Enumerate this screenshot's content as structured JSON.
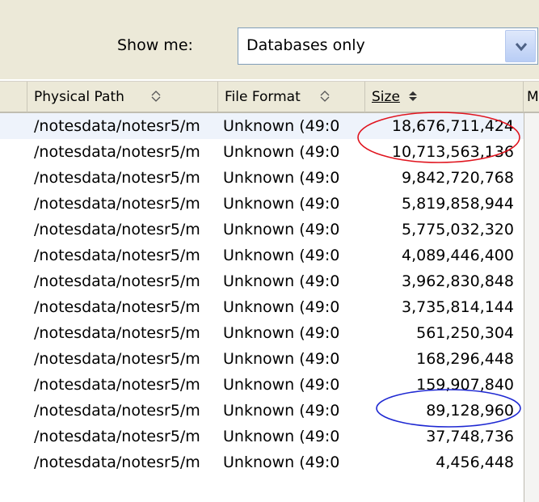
{
  "filter": {
    "label": "Show me:",
    "selected": "Databases only"
  },
  "columns": {
    "path": "Physical Path",
    "format": "File Format",
    "size": "Size",
    "next": "M"
  },
  "rows": [
    {
      "path": "/notesdata/notesr5/m",
      "format": "Unknown (49:0",
      "size": "18,676,711,424"
    },
    {
      "path": "/notesdata/notesr5/m",
      "format": "Unknown (49:0",
      "size": "10,713,563,136"
    },
    {
      "path": "/notesdata/notesr5/m",
      "format": "Unknown (49:0",
      "size": "9,842,720,768"
    },
    {
      "path": "/notesdata/notesr5/m",
      "format": "Unknown (49:0",
      "size": "5,819,858,944"
    },
    {
      "path": "/notesdata/notesr5/m",
      "format": "Unknown (49:0",
      "size": "5,775,032,320"
    },
    {
      "path": "/notesdata/notesr5/m",
      "format": "Unknown (49:0",
      "size": "4,089,446,400"
    },
    {
      "path": "/notesdata/notesr5/m",
      "format": "Unknown (49:0",
      "size": "3,962,830,848"
    },
    {
      "path": "/notesdata/notesr5/m",
      "format": "Unknown (49:0",
      "size": "3,735,814,144"
    },
    {
      "path": "/notesdata/notesr5/m",
      "format": "Unknown (49:0",
      "size": "561,250,304"
    },
    {
      "path": "/notesdata/notesr5/m",
      "format": "Unknown (49:0",
      "size": "168,296,448"
    },
    {
      "path": "/notesdata/notesr5/m",
      "format": "Unknown (49:0",
      "size": "159,907,840"
    },
    {
      "path": "/notesdata/notesr5/m",
      "format": "Unknown (49:0",
      "size": "89,128,960"
    },
    {
      "path": "/notesdata/notesr5/m",
      "format": "Unknown (49:0",
      "size": "37,748,736"
    },
    {
      "path": "/notesdata/notesr5/m",
      "format": "Unknown (49:0",
      "size": "4,456,448"
    }
  ],
  "icons": {
    "dropdown": "chevron-down-icon",
    "sort": "sort-updown-icon",
    "sort_active": "sort-active-icon"
  },
  "colors": {
    "highlight_red": "#e0141e",
    "highlight_blue": "#1e28d2",
    "window_bg": "#ece9d8"
  }
}
